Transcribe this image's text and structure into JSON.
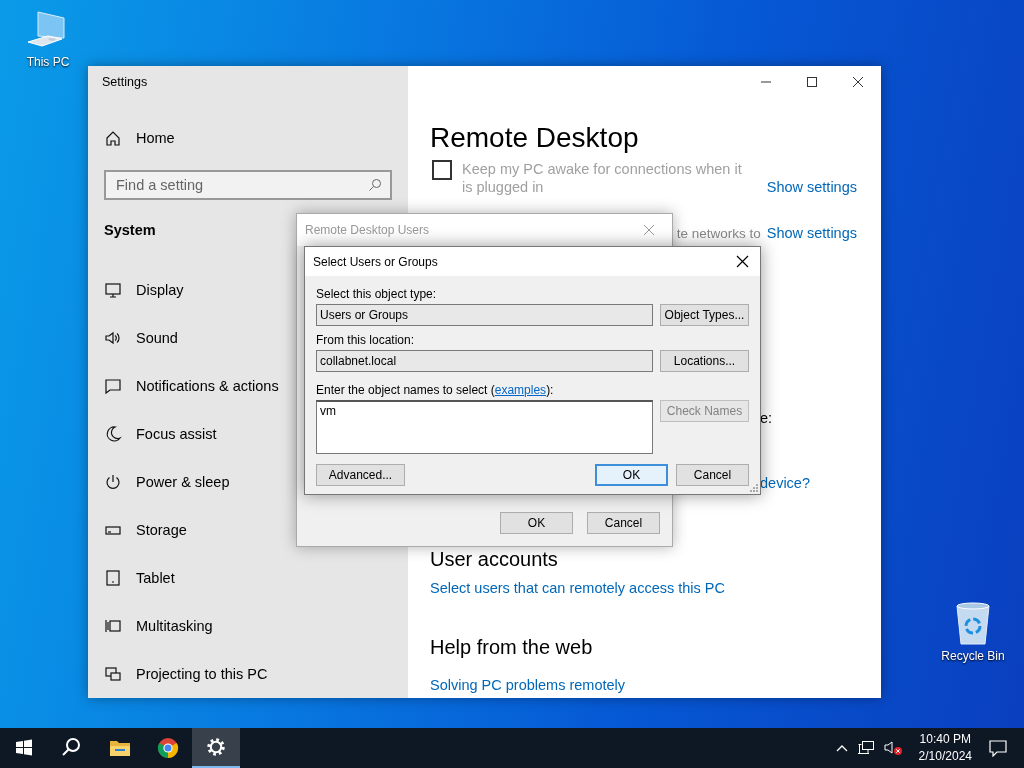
{
  "desktop_icons": [
    {
      "label": "This PC",
      "kind": "computer"
    },
    {
      "label": "Recycle Bin",
      "kind": "recycle_bin"
    }
  ],
  "settings": {
    "title": "Settings",
    "home": "Home",
    "search": {
      "placeholder": "Find a setting"
    },
    "section": "System",
    "nav": [
      {
        "label": "Display",
        "kind": "display",
        "selected": false
      },
      {
        "label": "Sound",
        "kind": "sound",
        "selected": false
      },
      {
        "label": "Notifications & actions",
        "kind": "notifications",
        "selected": false
      },
      {
        "label": "Focus assist",
        "kind": "focus",
        "selected": false
      },
      {
        "label": "Power & sleep",
        "kind": "power",
        "selected": false
      },
      {
        "label": "Storage",
        "kind": "storage",
        "selected": false
      },
      {
        "label": "Tablet",
        "kind": "tablet",
        "selected": false
      },
      {
        "label": "Multitasking",
        "kind": "multitasking",
        "selected": false
      },
      {
        "label": "Projecting to this PC",
        "kind": "projecting",
        "selected": false
      }
    ],
    "heading": "Remote Desktop",
    "keep_awake": {
      "label": "Keep my PC awake for connections when it is plugged in",
      "checked": false,
      "disabled": true
    },
    "show_settings_1": "Show settings",
    "partial_text_1": "te networks to",
    "show_settings_2": "Show settings",
    "partial_text_2": "e:",
    "partial_link": "device?",
    "user_accounts": {
      "heading": "User accounts",
      "link": "Select users that can remotely access this PC"
    },
    "help": {
      "heading": "Help from the web",
      "link": "Solving PC problems remotely"
    }
  },
  "remote_desktop_users": {
    "title": "Remote Desktop Users",
    "active": false,
    "buttons": [
      {
        "label": "OK"
      },
      {
        "label": "Cancel"
      }
    ]
  },
  "select_users": {
    "title": "Select Users or Groups",
    "active": true,
    "object_type": {
      "label": "Select this object type:",
      "value": "Users or Groups",
      "button": "Object Types..."
    },
    "location": {
      "label": "From this location:",
      "value": "collabnet.local",
      "button": "Locations..."
    },
    "names": {
      "label_before": "Enter the object names to select (",
      "link": "examples",
      "label_after": "):",
      "value": "vm",
      "button": {
        "label": "Check Names",
        "disabled": true
      }
    },
    "buttons": [
      {
        "label": "Advanced...",
        "default": false
      },
      {
        "label": "OK",
        "default": true
      },
      {
        "label": "Cancel",
        "default": false
      }
    ]
  },
  "taskbar": {
    "apps": [
      {
        "kind": "start",
        "selected": false
      },
      {
        "kind": "search",
        "selected": false
      },
      {
        "kind": "file_explorer",
        "selected": false
      },
      {
        "kind": "browser",
        "selected": false
      },
      {
        "kind": "settings",
        "selected": true
      }
    ],
    "time": "10:40 PM",
    "date": "2/10/2024"
  }
}
